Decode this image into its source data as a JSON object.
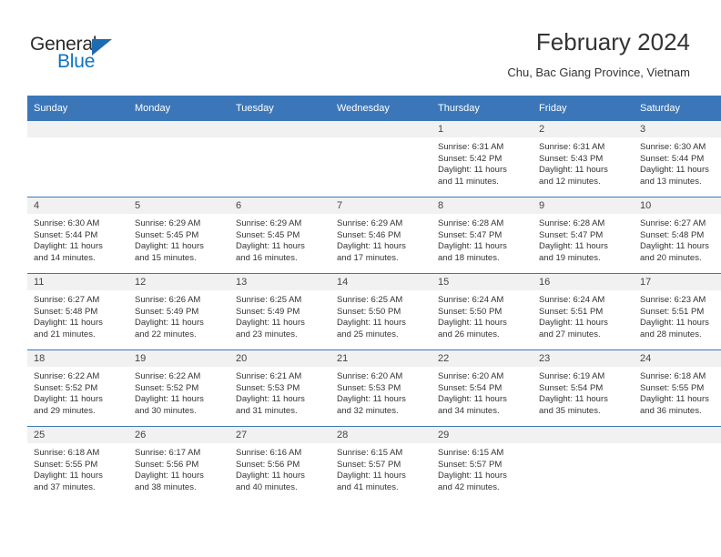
{
  "brand": {
    "name_top": "General",
    "name_bottom": "Blue",
    "triangle_color": "#1d6cb0",
    "blue_text_color": "#1073bd"
  },
  "header": {
    "title": "February 2024",
    "subtitle": "Chu, Bac Giang Province, Vietnam"
  },
  "theme": {
    "header_blue": "#3b77b8",
    "daynum_band": "#f1f1f1",
    "text": "#333333"
  },
  "weekday_headers": [
    "Sunday",
    "Monday",
    "Tuesday",
    "Wednesday",
    "Thursday",
    "Friday",
    "Saturday"
  ],
  "labels": {
    "sunrise_prefix": "Sunrise:",
    "sunset_prefix": "Sunset:",
    "daylight_prefix": "Daylight:"
  },
  "weeks": [
    [
      {
        "day": "",
        "line1": "",
        "line2": "",
        "line3": "",
        "line4": ""
      },
      {
        "day": "",
        "line1": "",
        "line2": "",
        "line3": "",
        "line4": ""
      },
      {
        "day": "",
        "line1": "",
        "line2": "",
        "line3": "",
        "line4": ""
      },
      {
        "day": "",
        "line1": "",
        "line2": "",
        "line3": "",
        "line4": ""
      },
      {
        "day": "1",
        "line1": "Sunrise: 6:31 AM",
        "line2": "Sunset: 5:42 PM",
        "line3": "Daylight: 11 hours",
        "line4": "and 11 minutes."
      },
      {
        "day": "2",
        "line1": "Sunrise: 6:31 AM",
        "line2": "Sunset: 5:43 PM",
        "line3": "Daylight: 11 hours",
        "line4": "and 12 minutes."
      },
      {
        "day": "3",
        "line1": "Sunrise: 6:30 AM",
        "line2": "Sunset: 5:44 PM",
        "line3": "Daylight: 11 hours",
        "line4": "and 13 minutes."
      }
    ],
    [
      {
        "day": "4",
        "line1": "Sunrise: 6:30 AM",
        "line2": "Sunset: 5:44 PM",
        "line3": "Daylight: 11 hours",
        "line4": "and 14 minutes."
      },
      {
        "day": "5",
        "line1": "Sunrise: 6:29 AM",
        "line2": "Sunset: 5:45 PM",
        "line3": "Daylight: 11 hours",
        "line4": "and 15 minutes."
      },
      {
        "day": "6",
        "line1": "Sunrise: 6:29 AM",
        "line2": "Sunset: 5:45 PM",
        "line3": "Daylight: 11 hours",
        "line4": "and 16 minutes."
      },
      {
        "day": "7",
        "line1": "Sunrise: 6:29 AM",
        "line2": "Sunset: 5:46 PM",
        "line3": "Daylight: 11 hours",
        "line4": "and 17 minutes."
      },
      {
        "day": "8",
        "line1": "Sunrise: 6:28 AM",
        "line2": "Sunset: 5:47 PM",
        "line3": "Daylight: 11 hours",
        "line4": "and 18 minutes."
      },
      {
        "day": "9",
        "line1": "Sunrise: 6:28 AM",
        "line2": "Sunset: 5:47 PM",
        "line3": "Daylight: 11 hours",
        "line4": "and 19 minutes."
      },
      {
        "day": "10",
        "line1": "Sunrise: 6:27 AM",
        "line2": "Sunset: 5:48 PM",
        "line3": "Daylight: 11 hours",
        "line4": "and 20 minutes."
      }
    ],
    [
      {
        "day": "11",
        "line1": "Sunrise: 6:27 AM",
        "line2": "Sunset: 5:48 PM",
        "line3": "Daylight: 11 hours",
        "line4": "and 21 minutes."
      },
      {
        "day": "12",
        "line1": "Sunrise: 6:26 AM",
        "line2": "Sunset: 5:49 PM",
        "line3": "Daylight: 11 hours",
        "line4": "and 22 minutes."
      },
      {
        "day": "13",
        "line1": "Sunrise: 6:25 AM",
        "line2": "Sunset: 5:49 PM",
        "line3": "Daylight: 11 hours",
        "line4": "and 23 minutes."
      },
      {
        "day": "14",
        "line1": "Sunrise: 6:25 AM",
        "line2": "Sunset: 5:50 PM",
        "line3": "Daylight: 11 hours",
        "line4": "and 25 minutes."
      },
      {
        "day": "15",
        "line1": "Sunrise: 6:24 AM",
        "line2": "Sunset: 5:50 PM",
        "line3": "Daylight: 11 hours",
        "line4": "and 26 minutes."
      },
      {
        "day": "16",
        "line1": "Sunrise: 6:24 AM",
        "line2": "Sunset: 5:51 PM",
        "line3": "Daylight: 11 hours",
        "line4": "and 27 minutes."
      },
      {
        "day": "17",
        "line1": "Sunrise: 6:23 AM",
        "line2": "Sunset: 5:51 PM",
        "line3": "Daylight: 11 hours",
        "line4": "and 28 minutes."
      }
    ],
    [
      {
        "day": "18",
        "line1": "Sunrise: 6:22 AM",
        "line2": "Sunset: 5:52 PM",
        "line3": "Daylight: 11 hours",
        "line4": "and 29 minutes."
      },
      {
        "day": "19",
        "line1": "Sunrise: 6:22 AM",
        "line2": "Sunset: 5:52 PM",
        "line3": "Daylight: 11 hours",
        "line4": "and 30 minutes."
      },
      {
        "day": "20",
        "line1": "Sunrise: 6:21 AM",
        "line2": "Sunset: 5:53 PM",
        "line3": "Daylight: 11 hours",
        "line4": "and 31 minutes."
      },
      {
        "day": "21",
        "line1": "Sunrise: 6:20 AM",
        "line2": "Sunset: 5:53 PM",
        "line3": "Daylight: 11 hours",
        "line4": "and 32 minutes."
      },
      {
        "day": "22",
        "line1": "Sunrise: 6:20 AM",
        "line2": "Sunset: 5:54 PM",
        "line3": "Daylight: 11 hours",
        "line4": "and 34 minutes."
      },
      {
        "day": "23",
        "line1": "Sunrise: 6:19 AM",
        "line2": "Sunset: 5:54 PM",
        "line3": "Daylight: 11 hours",
        "line4": "and 35 minutes."
      },
      {
        "day": "24",
        "line1": "Sunrise: 6:18 AM",
        "line2": "Sunset: 5:55 PM",
        "line3": "Daylight: 11 hours",
        "line4": "and 36 minutes."
      }
    ],
    [
      {
        "day": "25",
        "line1": "Sunrise: 6:18 AM",
        "line2": "Sunset: 5:55 PM",
        "line3": "Daylight: 11 hours",
        "line4": "and 37 minutes."
      },
      {
        "day": "26",
        "line1": "Sunrise: 6:17 AM",
        "line2": "Sunset: 5:56 PM",
        "line3": "Daylight: 11 hours",
        "line4": "and 38 minutes."
      },
      {
        "day": "27",
        "line1": "Sunrise: 6:16 AM",
        "line2": "Sunset: 5:56 PM",
        "line3": "Daylight: 11 hours",
        "line4": "and 40 minutes."
      },
      {
        "day": "28",
        "line1": "Sunrise: 6:15 AM",
        "line2": "Sunset: 5:57 PM",
        "line3": "Daylight: 11 hours",
        "line4": "and 41 minutes."
      },
      {
        "day": "29",
        "line1": "Sunrise: 6:15 AM",
        "line2": "Sunset: 5:57 PM",
        "line3": "Daylight: 11 hours",
        "line4": "and 42 minutes."
      },
      {
        "day": "",
        "line1": "",
        "line2": "",
        "line3": "",
        "line4": ""
      },
      {
        "day": "",
        "line1": "",
        "line2": "",
        "line3": "",
        "line4": ""
      }
    ]
  ]
}
